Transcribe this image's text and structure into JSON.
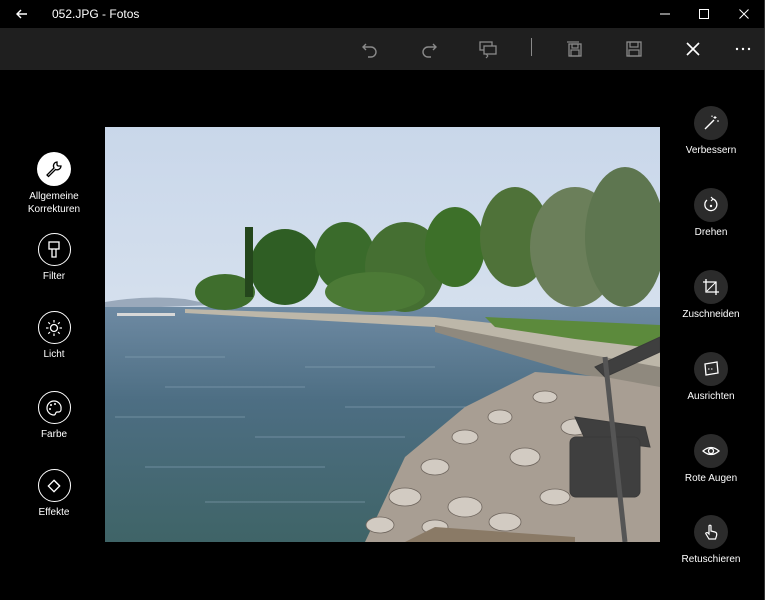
{
  "window": {
    "title": "052.JPG - Fotos"
  },
  "toolbar": {
    "buttons": [
      "undo-icon",
      "redo-icon",
      "compare-icon",
      "save-copy-icon",
      "save-icon",
      "close-icon",
      "more-icon"
    ]
  },
  "left_tools": [
    {
      "label": "Allgemeine Korrekturen",
      "icon": "wrench-icon",
      "active": true
    },
    {
      "label": "Filter",
      "icon": "brush-icon"
    },
    {
      "label": "Licht",
      "icon": "sun-icon"
    },
    {
      "label": "Farbe",
      "icon": "palette-icon"
    },
    {
      "label": "Effekte",
      "icon": "effects-icon"
    }
  ],
  "right_tools": [
    {
      "label": "Verbessern",
      "icon": "magic-wand-icon"
    },
    {
      "label": "Drehen",
      "icon": "rotate-icon"
    },
    {
      "label": "Zuschneiden",
      "icon": "crop-icon"
    },
    {
      "label": "Ausrichten",
      "icon": "straighten-icon"
    },
    {
      "label": "Rote Augen",
      "icon": "eye-icon"
    },
    {
      "label": "Retuschieren",
      "icon": "touch-icon"
    }
  ],
  "colors": {
    "background": "#000000",
    "toolbar": "#1f1f1f",
    "active_tool": "#ffffff"
  }
}
